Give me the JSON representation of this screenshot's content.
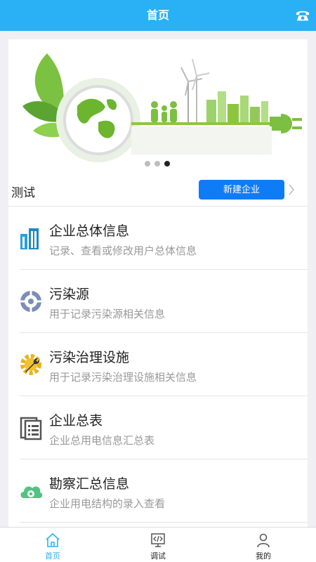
{
  "header": {
    "title": "首页"
  },
  "banner": {
    "dots": 3,
    "active_index": 2
  },
  "company": {
    "name": "测试",
    "new_button": "新建企业"
  },
  "menu": [
    {
      "title": "企业总体信息",
      "desc": "记录、查看或修改用户总体信息",
      "icon": "buildings-icon"
    },
    {
      "title": "污染源",
      "desc": "用于记录污染源相关信息",
      "icon": "target-icon"
    },
    {
      "title": "污染治理设施",
      "desc": "用于记录污染治理设施相关信息",
      "icon": "gear-wrench-icon"
    },
    {
      "title": "企业总表",
      "desc": "企业总用电信息汇总表",
      "icon": "document-icon"
    },
    {
      "title": "勘察汇总信息",
      "desc": "企业用电结构的录入查看",
      "icon": "cloud-gear-icon"
    }
  ],
  "tabbar": [
    {
      "label": "首页",
      "icon": "home-icon",
      "active": true
    },
    {
      "label": "调试",
      "icon": "code-icon",
      "active": false
    },
    {
      "label": "我的",
      "icon": "user-icon",
      "active": false
    }
  ],
  "colors": {
    "header": "#2ab0f5",
    "button": "#0f7cf7",
    "tab_active": "#2ab0f5"
  }
}
